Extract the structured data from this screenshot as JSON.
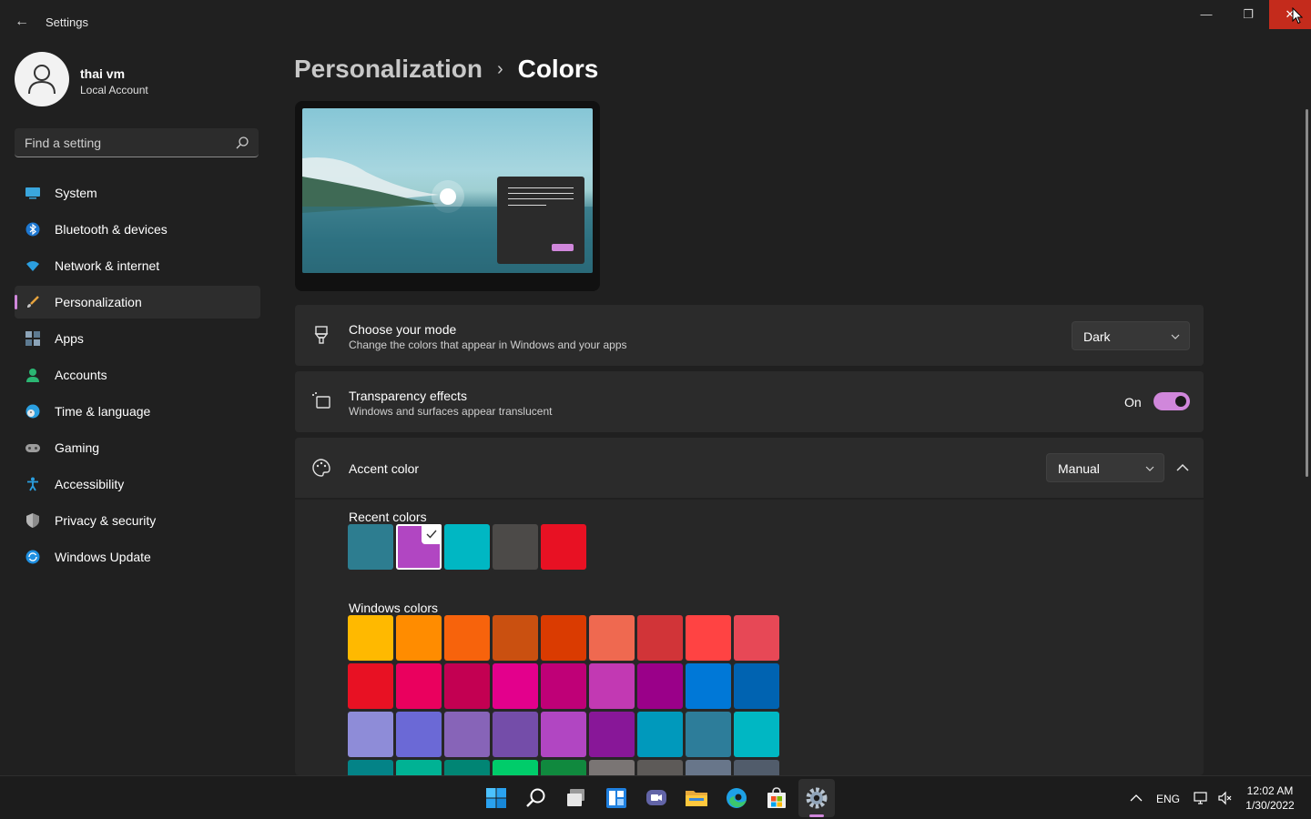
{
  "window": {
    "back_glyph": "←",
    "title": "Settings",
    "minimize_glyph": "—",
    "maximize_glyph": "❐",
    "close_glyph": "✕"
  },
  "profile": {
    "name": "thai vm",
    "account_type": "Local Account"
  },
  "search": {
    "placeholder": "Find a setting"
  },
  "sidebar": {
    "items": [
      {
        "label": "System",
        "icon": "system-icon"
      },
      {
        "label": "Bluetooth & devices",
        "icon": "bluetooth-icon"
      },
      {
        "label": "Network & internet",
        "icon": "wifi-icon"
      },
      {
        "label": "Personalization",
        "icon": "brush-icon",
        "selected": true
      },
      {
        "label": "Apps",
        "icon": "apps-icon"
      },
      {
        "label": "Accounts",
        "icon": "accounts-icon"
      },
      {
        "label": "Time & language",
        "icon": "clock-globe-icon"
      },
      {
        "label": "Gaming",
        "icon": "gamepad-icon"
      },
      {
        "label": "Accessibility",
        "icon": "accessibility-icon"
      },
      {
        "label": "Privacy & security",
        "icon": "shield-icon"
      },
      {
        "label": "Windows Update",
        "icon": "update-icon"
      }
    ]
  },
  "breadcrumb": {
    "parent": "Personalization",
    "separator": "›",
    "current": "Colors"
  },
  "mode": {
    "title": "Choose your mode",
    "subtitle": "Change the colors that appear in Windows and your apps",
    "value": "Dark"
  },
  "transparency": {
    "title": "Transparency effects",
    "subtitle": "Windows and surfaces appear translucent",
    "state_label": "On",
    "on": true
  },
  "accent": {
    "title": "Accent color",
    "value": "Manual",
    "recent_label": "Recent colors",
    "recent_colors": [
      "#2d7d90",
      "#b146c2",
      "#00b7c3",
      "#4c4a48",
      "#e81123"
    ],
    "selected_recent_index": 1,
    "windows_label": "Windows colors",
    "windows_colors": [
      [
        "#ffb900",
        "#ff8c00",
        "#f7630c",
        "#ca5010",
        "#da3b01",
        "#ef6950",
        "#d13438",
        "#ff4343",
        "#e74856"
      ],
      [
        "#e81123",
        "#ea005e",
        "#c30052",
        "#e3008c",
        "#bf0077",
        "#c239b3",
        "#9a0089",
        "#0078d7",
        "#0063b1"
      ],
      [
        "#8e8cd8",
        "#6b69d6",
        "#8764b8",
        "#744da9",
        "#b146c2",
        "#881798",
        "#0099bc",
        "#2d7d9a",
        "#00b7c3"
      ],
      [
        "#038387",
        "#00b294",
        "#018574",
        "#00cc6a",
        "#10893e",
        "#7a7574",
        "#5d5a58",
        "#68768a",
        "#515c6b"
      ]
    ]
  },
  "colors": {
    "accent": "#d087db",
    "background": "#202020",
    "card": "#2b2b2b",
    "close_button": "#c42b1c"
  },
  "taskbar": {
    "apps": [
      "start-icon",
      "search-icon",
      "task-view-icon",
      "widgets-icon",
      "chat-icon",
      "file-explorer-icon",
      "edge-icon",
      "store-icon",
      "settings-icon"
    ],
    "tray_language": "ENG",
    "tray_chevron": "^",
    "time": "12:02 AM",
    "date": "1/30/2022"
  }
}
